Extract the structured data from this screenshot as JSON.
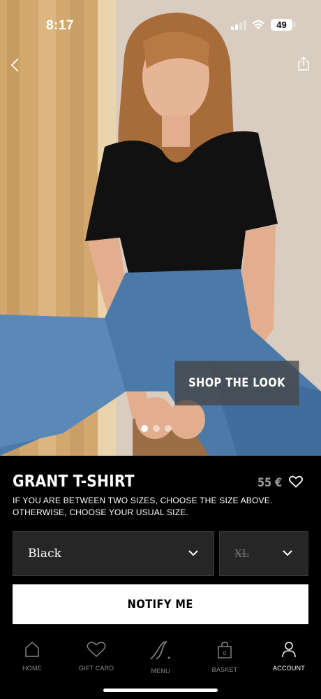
{
  "status_bar": {
    "time": "8:17",
    "battery": "49"
  },
  "hero": {
    "shop_the_look_label": "SHOP THE LOOK",
    "pager": {
      "count": 3,
      "active_index": 0
    },
    "colors": {
      "background": "#d9c9b4",
      "overlay_button": "#464646"
    }
  },
  "product": {
    "name": "GRANT T-SHIRT",
    "price": "55 €",
    "size_advice": "IF YOU ARE BETWEEN TWO SIZES, CHOOSE THE SIZE ABOVE. OTHERWISE, CHOOSE YOUR USUAL SIZE.",
    "color_select": {
      "value": "Black",
      "icon": "chevron-down-icon"
    },
    "size_select": {
      "value": "XL",
      "unavailable": true,
      "icon": "chevron-down-icon"
    },
    "notify_label": "NOTIFY ME"
  },
  "tab_bar": {
    "items": [
      {
        "label": "HOME",
        "icon": "home-icon",
        "active": false
      },
      {
        "label": "GIFT CARD",
        "icon": "heart-icon",
        "active": false
      },
      {
        "label": "MENU",
        "icon": "brand-logo-icon",
        "active": false
      },
      {
        "label": "BASKET",
        "icon": "basket-icon",
        "active": false,
        "count": "0"
      },
      {
        "label": "ACCOUNT",
        "icon": "account-icon",
        "active": true
      }
    ]
  },
  "colors": {
    "background": "#000000",
    "select_background": "#262626",
    "price": "#9c9c9c",
    "inactive_tab": "#8a8a8a"
  }
}
